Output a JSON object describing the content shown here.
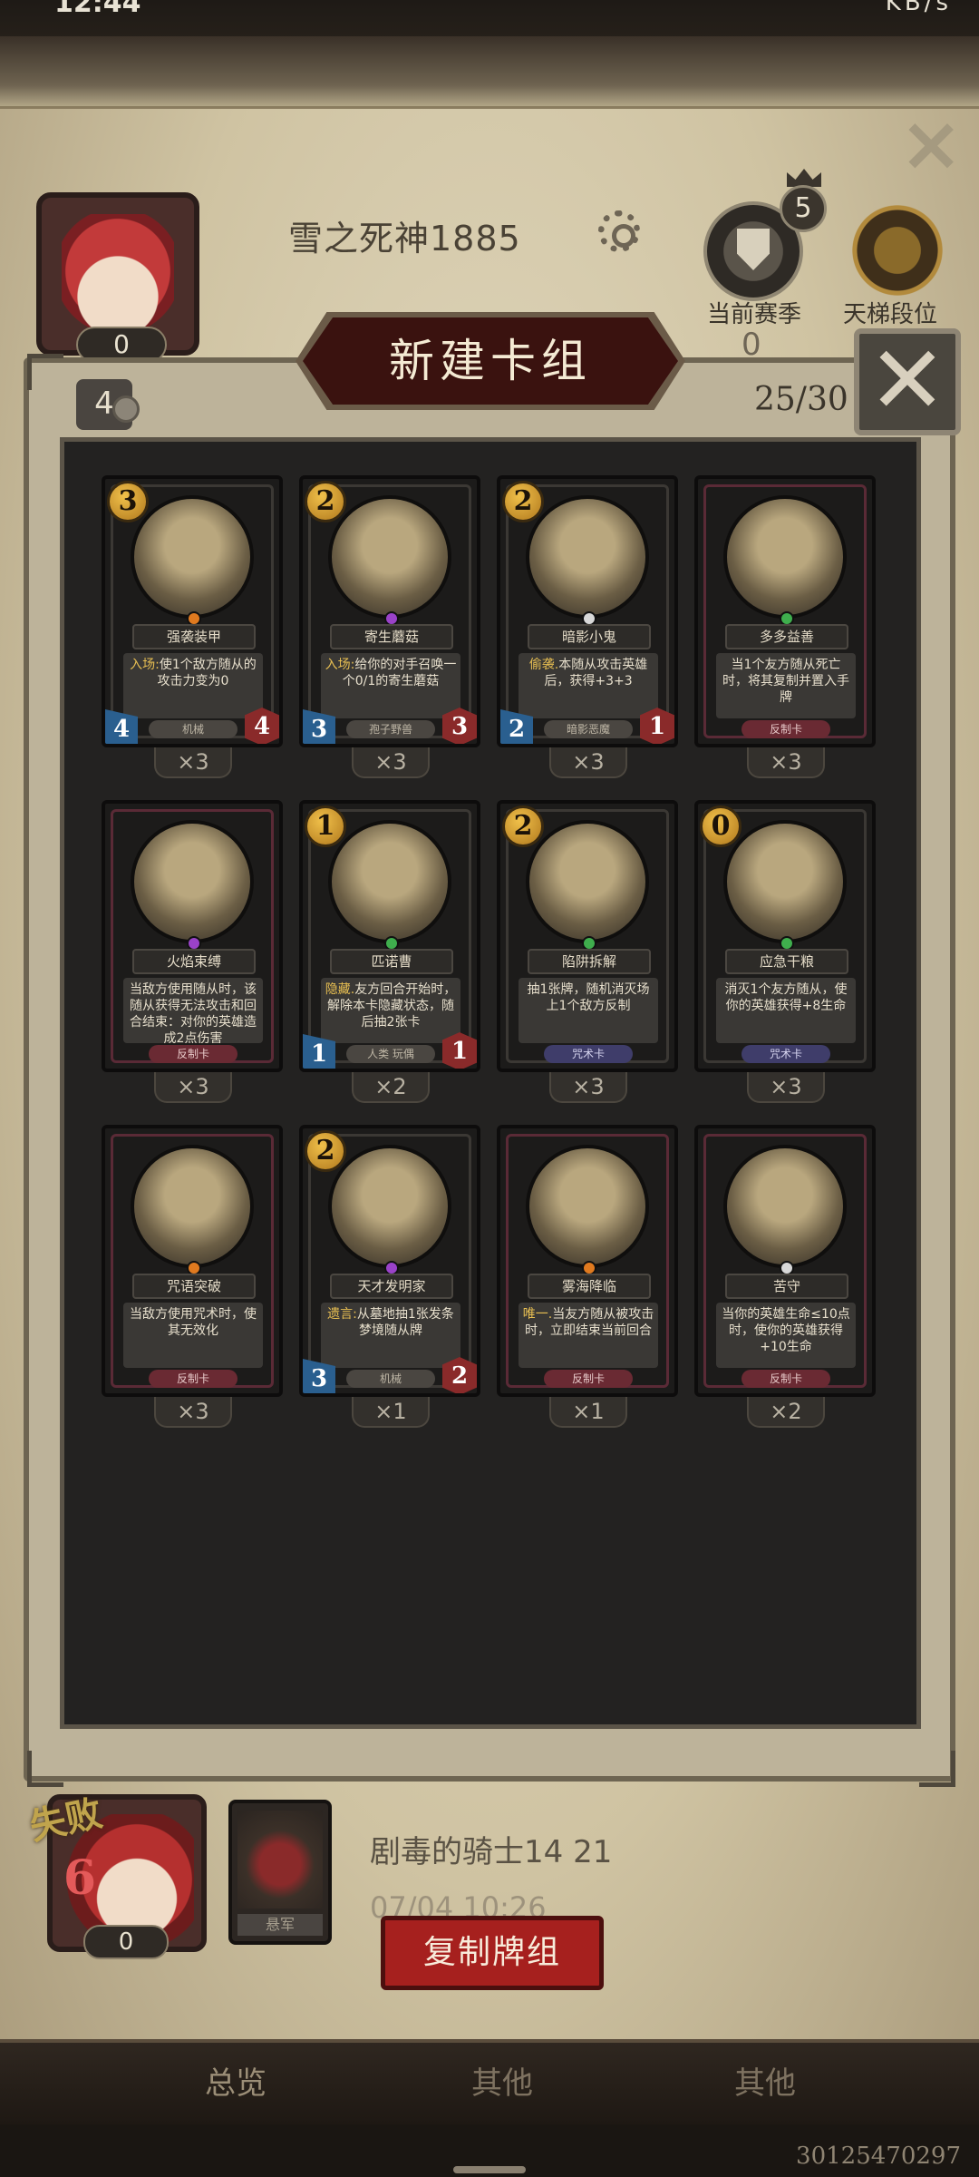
{
  "status_bar": {
    "time": "12:44",
    "right": "KB/s"
  },
  "profile": {
    "name": "雪之死神1885",
    "avatar_count": "0",
    "season_label": "当前赛季",
    "season_value": "0",
    "season_rank": "5",
    "ladder_label": "天梯段位"
  },
  "deck": {
    "title": "新建卡组",
    "count_chip": "4",
    "size": "25/30"
  },
  "cards": [
    {
      "cost": "3",
      "name": "强袭装甲",
      "desc_kw": "入场:",
      "desc": "使1个敌方随从的攻击力变为0",
      "type": "机械",
      "atk": "4",
      "hp": "4",
      "qty": "×3",
      "gem": "#e07a1f"
    },
    {
      "cost": "2",
      "name": "寄生蘑菇",
      "desc_kw": "入场:",
      "desc": "给你的对手召唤一个0/1的寄生蘑菇",
      "type": "孢子野兽",
      "atk": "3",
      "hp": "3",
      "qty": "×3",
      "gem": "#9a42c8"
    },
    {
      "cost": "2",
      "name": "暗影小鬼",
      "desc_kw": "偷袭.",
      "desc": "本随从攻击英雄后，获得+3+3",
      "type": "暗影恶魔",
      "atk": "2",
      "hp": "1",
      "qty": "×3",
      "gem": "#d8d8d8"
    },
    {
      "cost": "",
      "name": "多多益善",
      "desc_kw": "",
      "desc": "当1个友方随从死亡时，将其复制并置入手牌",
      "type": "反制卡",
      "atk": "",
      "hp": "",
      "qty": "×3",
      "gem": "#3fae4d"
    },
    {
      "cost": "",
      "name": "火焰束缚",
      "desc_kw": "",
      "desc": "当敌方使用随从时，该随从获得无法攻击和回合结束：对你的英雄造成2点伤害",
      "type": "反制卡",
      "atk": "",
      "hp": "",
      "qty": "×3",
      "gem": "#9a42c8"
    },
    {
      "cost": "1",
      "name": "匹诺曹",
      "desc_kw": "隐藏.",
      "desc": "友方回合开始时，解除本卡隐藏状态，随后抽2张卡",
      "type": "人类 玩偶",
      "atk": "1",
      "hp": "1",
      "qty": "×2",
      "gem": "#3fae4d"
    },
    {
      "cost": "2",
      "name": "陷阱拆解",
      "desc_kw": "",
      "desc": "抽1张牌，随机消灭场上1个敌方反制",
      "type": "咒术卡",
      "atk": "",
      "hp": "",
      "qty": "×3",
      "gem": "#3fae4d"
    },
    {
      "cost": "0",
      "name": "应急干粮",
      "desc_kw": "",
      "desc": "消灭1个友方随从，使你的英雄获得+8生命",
      "type": "咒术卡",
      "atk": "",
      "hp": "",
      "qty": "×3",
      "gem": "#3fae4d"
    },
    {
      "cost": "",
      "name": "咒语突破",
      "desc_kw": "",
      "desc": "当敌方使用咒术时，使其无效化",
      "type": "反制卡",
      "atk": "",
      "hp": "",
      "qty": "×3",
      "gem": "#e07a1f"
    },
    {
      "cost": "2",
      "name": "天才发明家",
      "desc_kw": "遗言:",
      "desc": "从墓地抽1张发条梦境随从牌",
      "type": "机械",
      "atk": "3",
      "hp": "2",
      "qty": "×1",
      "gem": "#9a42c8"
    },
    {
      "cost": "",
      "name": "雾海降临",
      "desc_kw": "唯一.",
      "desc": "当友方随从被攻击时，立即结束当前回合",
      "type": "反制卡",
      "atk": "",
      "hp": "",
      "qty": "×1",
      "gem": "#e07a1f"
    },
    {
      "cost": "",
      "name": "苦守",
      "desc_kw": "",
      "desc": "当你的英雄生命≤10点时，使你的英雄获得+10生命",
      "type": "反制卡",
      "atk": "",
      "hp": "",
      "qty": "×2",
      "gem": "#d8d8d8"
    }
  ],
  "match": {
    "result_label": "失败",
    "result_number": "6",
    "result_count": "0",
    "hero_label": "悬军",
    "opponent_name": "剧毒的骑士14 21",
    "time": "07/04 10:26",
    "copy_button": "复制牌组"
  },
  "nav": [
    "总览",
    "其他",
    "其他"
  ],
  "footer_id": "30125470297"
}
